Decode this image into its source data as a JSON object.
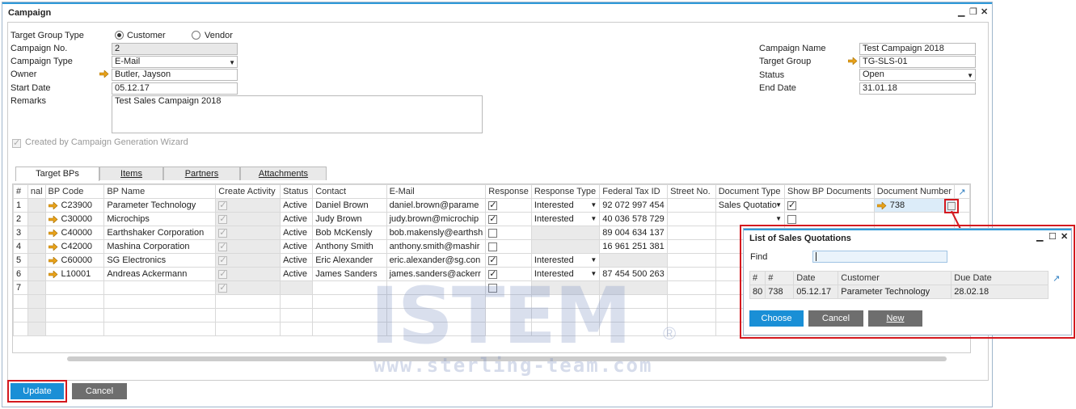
{
  "window": {
    "title": "Campaign"
  },
  "header": {
    "target_group_type_label": "Target Group Type",
    "radio_customer": "Customer",
    "radio_vendor": "Vendor",
    "campaign_no_label": "Campaign No.",
    "campaign_no": "2",
    "campaign_type_label": "Campaign Type",
    "campaign_type": "E-Mail",
    "owner_label": "Owner",
    "owner": "Butler, Jayson",
    "start_date_label": "Start Date",
    "start_date": "05.12.17",
    "remarks_label": "Remarks",
    "remarks": "Test Sales Campaign 2018",
    "campaign_name_label": "Campaign Name",
    "campaign_name": "Test Campaign 2018",
    "target_group_label": "Target Group",
    "target_group": "TG-SLS-01",
    "status_label": "Status",
    "status": "Open",
    "end_date_label": "End Date",
    "end_date": "31.01.18",
    "wizard_label": "Created by Campaign Generation Wizard"
  },
  "tabs": [
    "Target BPs",
    "Items",
    "Partners",
    "Attachments"
  ],
  "grid": {
    "columns": [
      "#",
      "nal",
      "BP Code",
      "BP Name",
      "Create Activity",
      "Status",
      "Contact",
      "E-Mail",
      "Response",
      "Response Type",
      "Federal Tax ID",
      "Street No.",
      "Document Type",
      "Show BP Documents",
      "Document Number"
    ],
    "rows": [
      {
        "n": "1",
        "code": "C23900",
        "name": "Parameter Technology",
        "status": "Active",
        "contact": "Daniel Brown",
        "email": "daniel.brown@parame",
        "response": true,
        "rtype": "Interested",
        "tax": "92 072 997 454",
        "doctype": "Sales Quotatio",
        "showbp": true,
        "docnum": "738"
      },
      {
        "n": "2",
        "code": "C30000",
        "name": "Microchips",
        "status": "Active",
        "contact": "Judy Brown",
        "email": "judy.brown@microchip",
        "response": true,
        "rtype": "Interested",
        "tax": "40 036 578 729",
        "doctype": "",
        "showbp": false,
        "docnum": ""
      },
      {
        "n": "3",
        "code": "C40000",
        "name": "Earthshaker Corporation",
        "status": "Active",
        "contact": "Bob McKensly",
        "email": "bob.makensly@earthsh",
        "response": false,
        "rtype": "",
        "tax": "89 004 634 137",
        "doctype": "",
        "showbp": false,
        "docnum": ""
      },
      {
        "n": "4",
        "code": "C42000",
        "name": "Mashina Corporation",
        "status": "Active",
        "contact": "Anthony Smith",
        "email": "anthony.smith@mashir",
        "response": false,
        "rtype": "",
        "tax": "16 961 251 381",
        "doctype": "",
        "showbp": false,
        "docnum": ""
      },
      {
        "n": "5",
        "code": "C60000",
        "name": "SG Electronics",
        "status": "Active",
        "contact": "Eric Alexander",
        "email": "eric.alexander@sg.con",
        "response": true,
        "rtype": "Interested",
        "tax": "",
        "doctype": "",
        "showbp": false,
        "docnum": ""
      },
      {
        "n": "6",
        "code": "L10001",
        "name": "Andreas Ackermann",
        "status": "Active",
        "contact": "James Sanders",
        "email": "james.sanders@ackerr",
        "response": true,
        "rtype": "Interested",
        "tax": "87 454 500 263",
        "doctype": "",
        "showbp": false,
        "docnum": ""
      },
      {
        "n": "7",
        "code": "",
        "name": "",
        "status": "",
        "contact": "",
        "email": "",
        "response": false,
        "rtype": "",
        "tax": "",
        "doctype": "",
        "showbp": false,
        "docnum": ""
      }
    ]
  },
  "popup": {
    "title": "List of Sales Quotations",
    "find_label": "Find",
    "columns": [
      "#",
      "#",
      "Date",
      "Customer",
      "Due Date"
    ],
    "rows": [
      [
        "80",
        "738",
        "05.12.17",
        "Parameter Technology",
        "28.02.18"
      ]
    ],
    "choose": "Choose",
    "cancel": "Cancel",
    "new": "New"
  },
  "buttons": {
    "update": "Update",
    "cancel": "Cancel"
  },
  "watermark": {
    "logo": "ISTEM",
    "url": "www.sterling-team.com"
  },
  "colors": {
    "accent": "#2f9ad9",
    "button_blue": "#1a8fd6",
    "highlight_red": "#d4191f",
    "link_arrow": "#e8a21b"
  }
}
